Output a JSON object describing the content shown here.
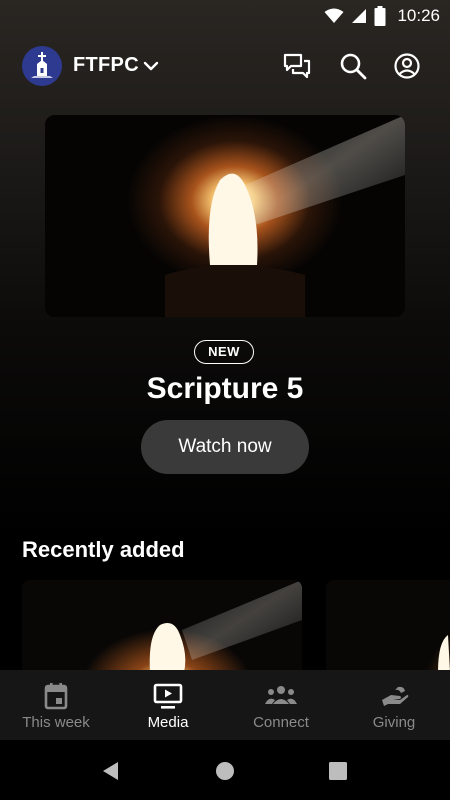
{
  "status_bar": {
    "time": "10:26",
    "icons": [
      "wifi-icon",
      "signal-icon",
      "battery-icon"
    ]
  },
  "header": {
    "org_name": "FTFPC",
    "logo_icon": "church-logo",
    "actions": [
      "chat-icon",
      "search-icon",
      "account-icon"
    ]
  },
  "hero": {
    "badge": "NEW",
    "title": "Scripture 5",
    "button_label": "Watch now"
  },
  "recently_added": {
    "title": "Recently added",
    "items": [
      {
        "thumbnail": "empty-tomb-image"
      },
      {
        "thumbnail": "empty-tomb-image"
      }
    ]
  },
  "bottom_nav": {
    "items": [
      {
        "label": "This week",
        "icon": "calendar-icon",
        "active": false
      },
      {
        "label": "Media",
        "icon": "tv-play-icon",
        "active": true
      },
      {
        "label": "Connect",
        "icon": "people-icon",
        "active": false
      },
      {
        "label": "Giving",
        "icon": "giving-hand-icon",
        "active": false
      }
    ]
  },
  "system_nav": [
    "back-button",
    "home-button",
    "recents-button"
  ],
  "colors": {
    "background": "#000000",
    "nav_background": "#161616",
    "button_background": "#3a3a3a",
    "inactive_label": "#8a8a8a",
    "logo_blue": "#2e3a8f"
  }
}
